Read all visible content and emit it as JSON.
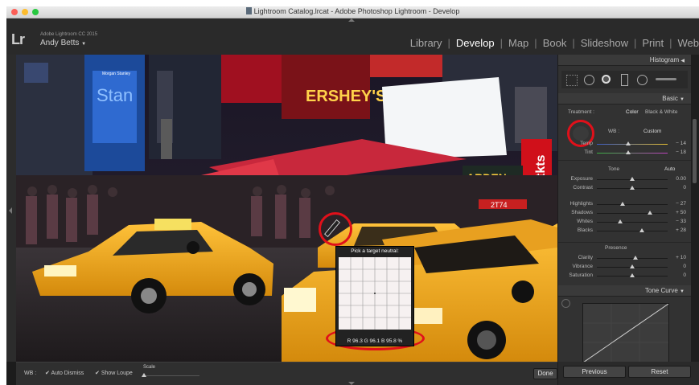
{
  "window": {
    "title": "Lightroom Catalog.lrcat - Adobe Photoshop Lightroom - Develop"
  },
  "identity": {
    "logo": "Lr",
    "version": "Adobe Lightroom CC 2015",
    "user": "Andy Betts",
    "user_caret": "▼"
  },
  "modules": [
    {
      "label": "Library",
      "active": false
    },
    {
      "label": "Develop",
      "active": true
    },
    {
      "label": "Map",
      "active": false
    },
    {
      "label": "Book",
      "active": false
    },
    {
      "label": "Slideshow",
      "active": false
    },
    {
      "label": "Print",
      "active": false
    },
    {
      "label": "Web",
      "active": false
    }
  ],
  "photo": {
    "signs": {
      "hershey": "ERSHEY'S",
      "tkts": "tkts",
      "garden": "ARDEN",
      "morgan": "Morgan Stanley",
      "taxi_number": "2T74"
    }
  },
  "loupe": {
    "title": "Pick a target neutral:",
    "readout": "R 96.3  G 96.1  B 95.8  %"
  },
  "toolbar": {
    "wb_label": "WB :",
    "auto_dismiss": "Auto Dismiss",
    "show_loupe": "Show Loupe",
    "scale": "Scale",
    "done": "Done"
  },
  "panel": {
    "histogram": "Histogram",
    "basic": "Basic",
    "treatment_label": "Treatment :",
    "treatment_color": "Color",
    "treatment_bw": "Black & White",
    "wb_label": "WB :",
    "wb_value": "Custom",
    "temp": {
      "label": "Temp",
      "value": "− 14",
      "pos": 0.44
    },
    "tint": {
      "label": "Tint",
      "value": "− 18",
      "pos": 0.44
    },
    "tone": "Tone",
    "tone_auto": "Auto",
    "sliders_tone": [
      {
        "label": "Exposure",
        "value": "0.00",
        "pos": 0.5
      },
      {
        "label": "Contrast",
        "value": "0",
        "pos": 0.5
      }
    ],
    "sliders_tone2": [
      {
        "label": "Highlights",
        "value": "− 27",
        "pos": 0.36
      },
      {
        "label": "Shadows",
        "value": "+ 50",
        "pos": 0.75
      },
      {
        "label": "Whites",
        "value": "− 33",
        "pos": 0.33
      },
      {
        "label": "Blacks",
        "value": "+ 28",
        "pos": 0.64
      }
    ],
    "presence": "Presence",
    "sliders_presence": [
      {
        "label": "Clarity",
        "value": "+ 10",
        "pos": 0.55
      },
      {
        "label": "Vibrance",
        "value": "0",
        "pos": 0.5
      },
      {
        "label": "Saturation",
        "value": "0",
        "pos": 0.5
      }
    ],
    "tone_curve": "Tone Curve",
    "previous": "Previous",
    "reset": "Reset"
  },
  "colors": {
    "accent_red": "#e0101a",
    "taxi_yellow": "#f0a81a",
    "panel_bg": "#323232"
  }
}
